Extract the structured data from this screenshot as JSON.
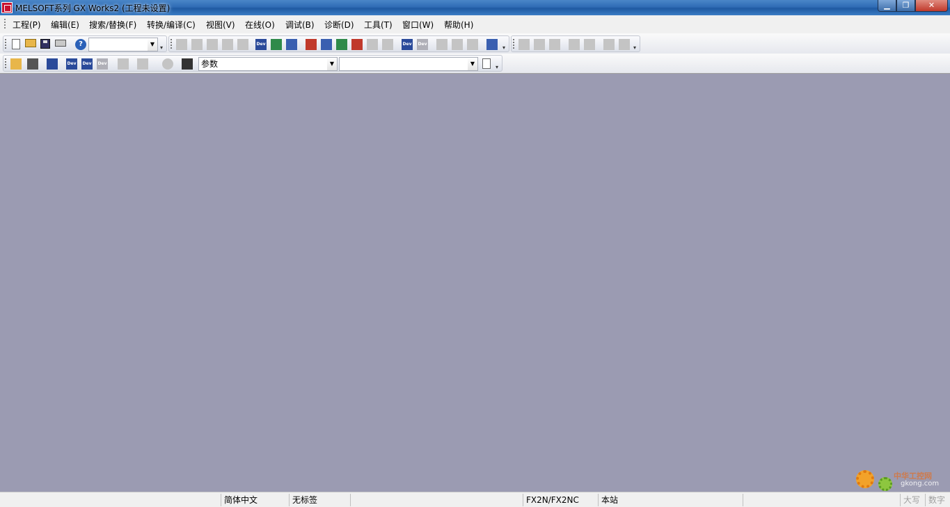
{
  "window": {
    "title": "MELSOFT系列 GX Works2 (工程未设置)",
    "controls": {
      "minimize": "▁",
      "maximize": "❐",
      "close": "✕"
    }
  },
  "menu": {
    "items": [
      "工程(P)",
      "编辑(E)",
      "搜索/替换(F)",
      "转换/编译(C)",
      "视图(V)",
      "在线(O)",
      "调试(B)",
      "诊断(D)",
      "工具(T)",
      "窗口(W)",
      "帮助(H)"
    ]
  },
  "toolbar": {
    "combo1_value": "",
    "combo_param_value": "参数",
    "combo3_value": "",
    "dev_label": "Dev",
    "overflow_glyph": "▾"
  },
  "statusbar": {
    "language": "简体中文",
    "label": "无标签",
    "plc_type": "FX2N/FX2NC",
    "station": "本站",
    "caps": "大写",
    "num": "数字"
  },
  "watermark": {
    "site_cn": "中华工控网",
    "site_url": "gkong.com"
  },
  "colors": {
    "workspace": "#9b9bb2",
    "titlebar": "#2f6cb5",
    "close_button": "#c0392b"
  }
}
